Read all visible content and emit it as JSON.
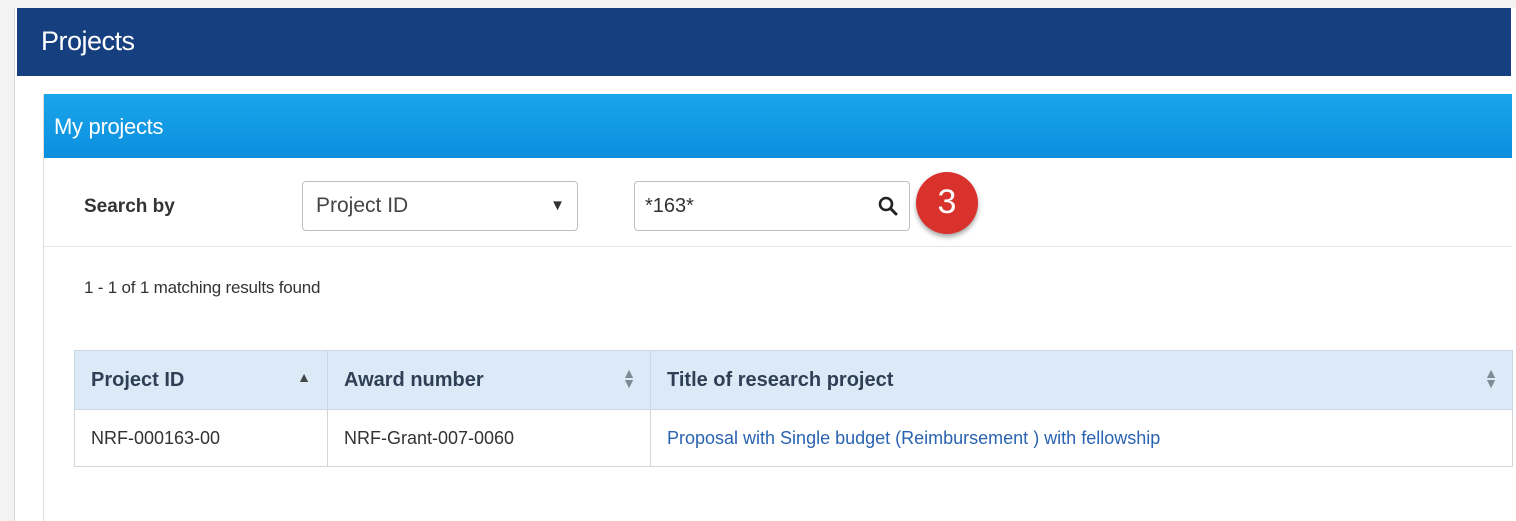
{
  "page": {
    "title": "Projects"
  },
  "panel": {
    "title": "My projects"
  },
  "search": {
    "label": "Search by",
    "field_selected": "Project ID",
    "query_value": "*163*"
  },
  "annotation": {
    "step_number": "3",
    "color": "#d9312c"
  },
  "results": {
    "summary": "1 - 1 of 1 matching results found"
  },
  "table": {
    "columns": [
      {
        "label": "Project ID",
        "sort": "ascending"
      },
      {
        "label": "Award number",
        "sort": "none"
      },
      {
        "label": "Title of research project",
        "sort": "none"
      }
    ],
    "rows": [
      {
        "project_id": "NRF-000163-00",
        "award_number": "NRF-Grant-007-0060",
        "title": "Proposal with Single budget (Reimbursement ) with fellowship"
      }
    ]
  },
  "colors": {
    "header_bg": "#163f80",
    "panel_header_bg": "#0b8fde",
    "table_header_bg": "#dce9f7",
    "link": "#2a63b0"
  },
  "icons": {
    "search": "search-icon",
    "select_caret": "caret-down-icon",
    "sort_asc": "sort-ascending-icon",
    "sort_both": "sort-both-icon"
  }
}
